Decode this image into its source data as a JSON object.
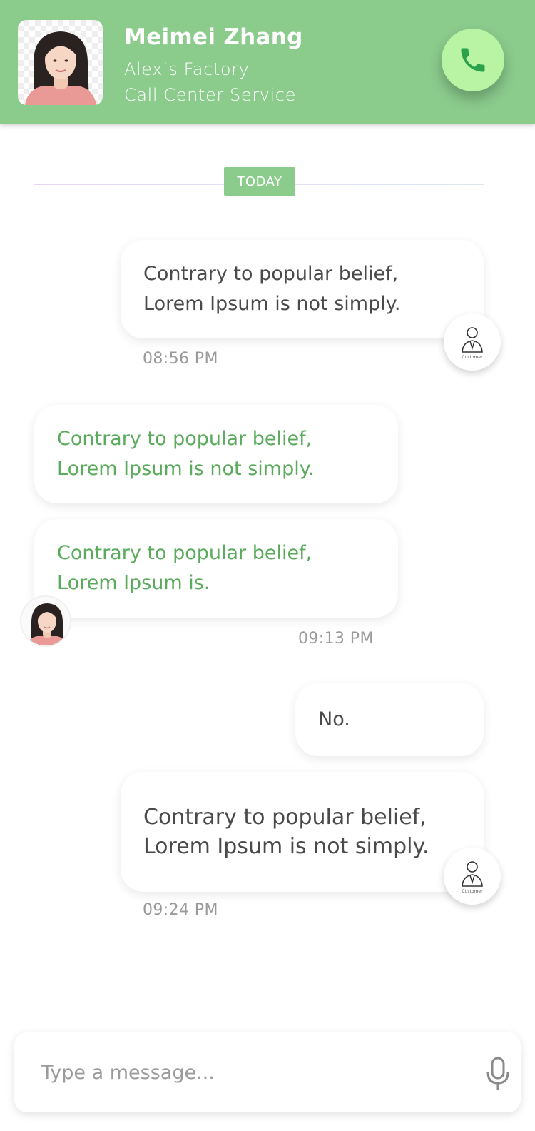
{
  "header": {
    "contact_name": "Meimei Zhang",
    "company": "Alex’s Factory",
    "department": "Call Center Service",
    "avatar_icon": "person-photo",
    "call_icon": "phone-icon",
    "background_color": "#8bcb8c",
    "call_button_color": "#b9f3a4",
    "call_icon_color": "#2aa24a"
  },
  "divider": {
    "label": "TODAY"
  },
  "messages": [
    {
      "direction": "outgoing",
      "text": "Contrary to popular belief,\nLorem Ipsum is not simply.",
      "time": "08:56 PM",
      "avatar_label": "Customer"
    },
    {
      "direction": "incoming",
      "text": "Contrary to popular belief,\nLorem Ipsum is not simply."
    },
    {
      "direction": "incoming",
      "text": "Contrary to popular belief,\nLorem Ipsum is.",
      "time": "09:13 PM"
    },
    {
      "direction": "outgoing",
      "text": "No."
    },
    {
      "direction": "outgoing",
      "text": "Contrary to popular belief,\nLorem Ipsum is not simply.",
      "time": "09:24 PM",
      "avatar_label": "Customer"
    }
  ],
  "composer": {
    "placeholder": "Type a message...",
    "value": "",
    "mic_icon": "microphone-icon"
  },
  "colors": {
    "incoming_text": "#5aab5c",
    "outgoing_text": "#4a4a4a",
    "timestamp": "#9a9a9a"
  }
}
